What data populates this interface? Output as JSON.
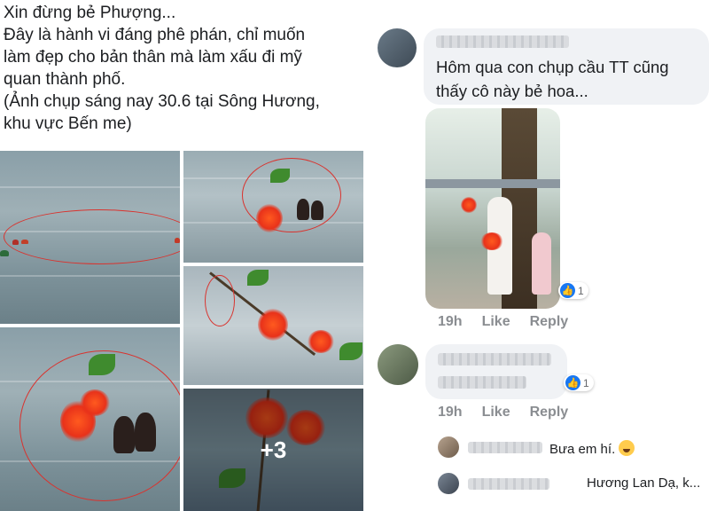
{
  "post": {
    "caption_lines": [
      "Xin đừng bẻ Phượng...",
      "Đây là hành vi đáng phê phán, chỉ muốn",
      "làm đẹp cho bản thân mà làm xấu đi mỹ",
      "quan thành phố.",
      "(Ảnh chụp sáng nay 30.6 tại Sông Hương,",
      "khu vực Bến me)"
    ],
    "more_photos_label": "+3"
  },
  "comments": [
    {
      "text_lines": [
        "Hôm qua con chụp cầu TT cũng",
        "thấy cô này bẻ hoa..."
      ],
      "reaction_count": "1",
      "time": "19h",
      "like_label": "Like",
      "reply_label": "Reply"
    },
    {
      "reaction_count": "1",
      "time": "19h",
      "like_label": "Like",
      "reply_label": "Reply"
    }
  ],
  "replies": [
    {
      "text": "Bưa em hí."
    },
    {
      "text": "Hương Lan Dạ, k..."
    }
  ],
  "colors": {
    "like_blue": "#1877f2",
    "bubble_bg": "#f0f2f5",
    "action_gray": "#8a8d91",
    "highlight_circle": "#d9332e"
  }
}
